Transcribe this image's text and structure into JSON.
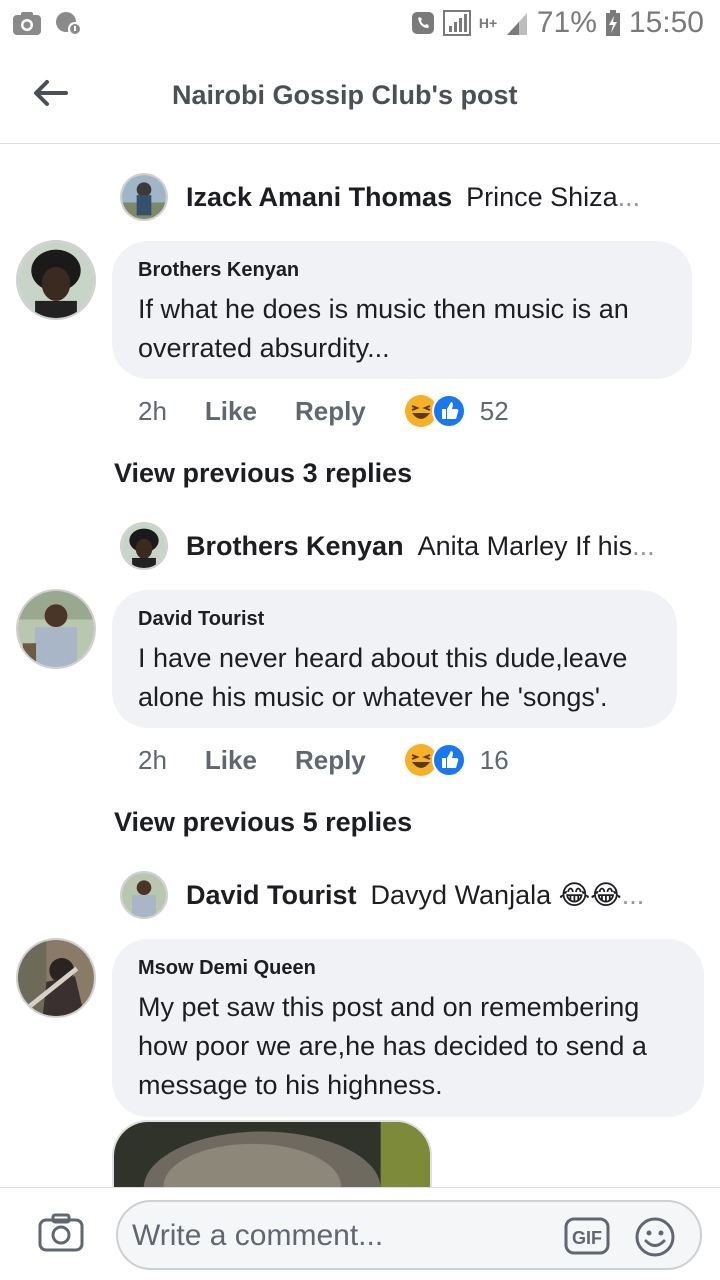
{
  "status_bar": {
    "battery": "71%",
    "time": "15:50",
    "network": "H+"
  },
  "header": {
    "title": "Nairobi Gossip Club's post"
  },
  "threads": [
    {
      "collapsed_reply": {
        "author": "Izack Amani Thomas",
        "preview": "Prince Shiza",
        "ellipsis": "..."
      },
      "comment": {
        "author": "Brothers Kenyan",
        "text_lines": [
          "If what he does is music then music is an",
          "overrated absurdity..."
        ],
        "time": "2h",
        "like_label": "Like",
        "reply_label": "Reply",
        "reaction_count": "52"
      },
      "view_previous": "View previous 3 replies"
    },
    {
      "collapsed_reply": {
        "author": "Brothers Kenyan",
        "preview": "Anita Marley If his",
        "ellipsis": "..."
      },
      "comment": {
        "author": "David Tourist",
        "text_lines": [
          "I have never heard about this dude,leave",
          "alone his music or whatever  he 'songs'."
        ],
        "time": "2h",
        "like_label": "Like",
        "reply_label": "Reply",
        "reaction_count": "16"
      },
      "view_previous": "View previous 5 replies"
    },
    {
      "collapsed_reply": {
        "author": "David Tourist",
        "preview": "Davyd Wanjala 😂😂",
        "ellipsis": "..."
      },
      "comment": {
        "author": "Msow Demi Queen",
        "text_lines": [
          "My pet saw this post and on remembering",
          "how poor we are,he has decided to send a",
          "message to his highness."
        ]
      }
    }
  ],
  "composer": {
    "placeholder": "Write a comment...",
    "gif_label": "GIF"
  },
  "colors": {
    "bubble_bg": "#f0f2f5",
    "meta_text": "#606770",
    "like_blue": "#1877f2",
    "haha_yellow": "#f7b125"
  },
  "icons": [
    "camera-icon",
    "back-arrow-icon",
    "gif-icon",
    "emoji-icon",
    "haha-reaction-icon",
    "like-reaction-icon"
  ]
}
